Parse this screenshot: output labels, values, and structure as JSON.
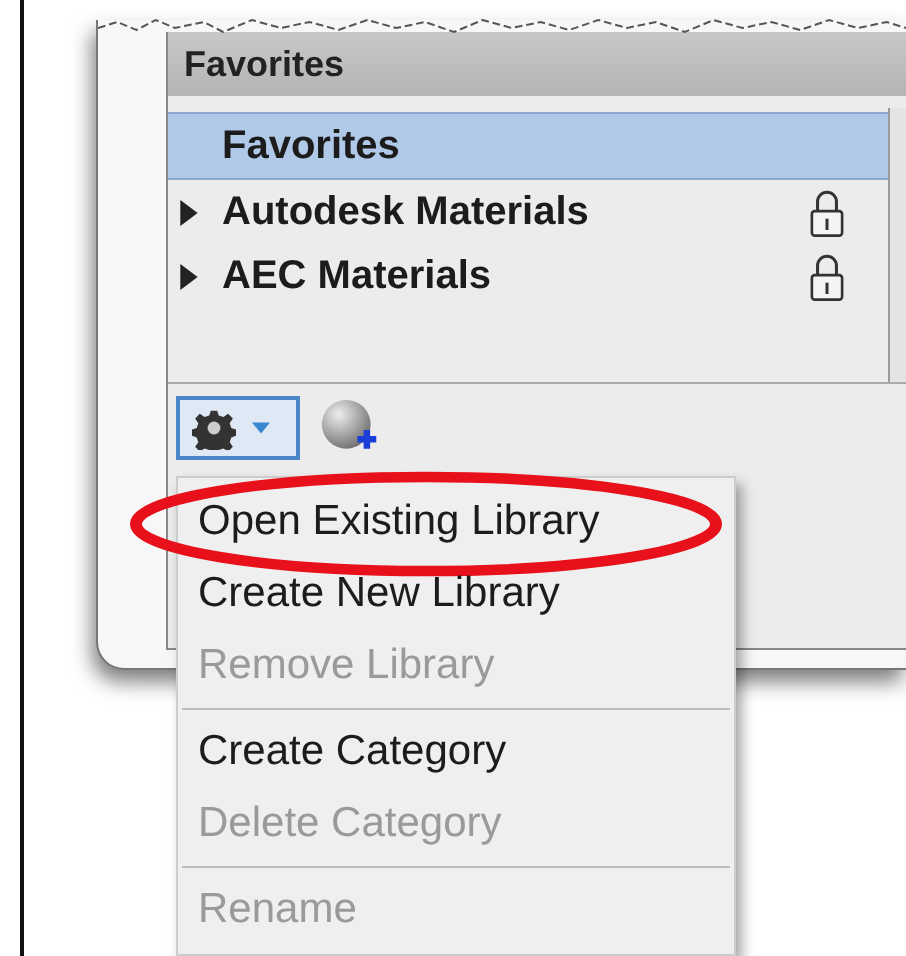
{
  "panel": {
    "title": "Favorites"
  },
  "tree": [
    {
      "label": "Favorites",
      "selected": true,
      "expandable": false,
      "locked": false
    },
    {
      "label": "Autodesk Materials",
      "selected": false,
      "expandable": true,
      "locked": true
    },
    {
      "label": "AEC Materials",
      "selected": false,
      "expandable": true,
      "locked": true
    }
  ],
  "menu": [
    [
      {
        "label": "Open Existing Library",
        "disabled": false,
        "circled": true
      },
      {
        "label": "Create New Library",
        "disabled": false,
        "circled": false
      },
      {
        "label": "Remove Library",
        "disabled": true,
        "circled": false
      }
    ],
    [
      {
        "label": "Create Category",
        "disabled": false,
        "circled": false
      },
      {
        "label": "Delete Category",
        "disabled": true,
        "circled": false
      }
    ],
    [
      {
        "label": "Rename",
        "disabled": true,
        "circled": false
      }
    ]
  ]
}
